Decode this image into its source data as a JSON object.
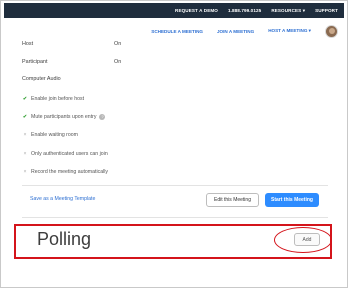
{
  "topbar": {
    "request_demo": "REQUEST A DEMO",
    "phone": "1.888.799.0125",
    "resources": "RESOURCES ▾",
    "support": "SUPPORT"
  },
  "nav": {
    "schedule": "SCHEDULE A MEETING",
    "join": "JOIN A MEETING",
    "host": "HOST A MEETING ▾"
  },
  "settings": {
    "host_label": "Host",
    "host_value": "On",
    "participant_label": "Participant",
    "participant_value": "On",
    "computer_audio_label": "Computer Audio"
  },
  "options": [
    {
      "label": "Enable join before host",
      "enabled": true
    },
    {
      "label": "Mute participants upon entry",
      "enabled": true
    },
    {
      "label": "Enable waiting room",
      "enabled": false
    },
    {
      "label": "Only authenticated users can join",
      "enabled": false
    },
    {
      "label": "Record the meeting automatically",
      "enabled": false
    }
  ],
  "icons": {
    "check": "check-icon",
    "cross": "x-icon",
    "info": "info-icon"
  },
  "actions": {
    "save_template": "Save as a Meeting Template",
    "edit": "Edit this Meeting",
    "start": "Start this Meeting"
  },
  "polling": {
    "title": "Polling",
    "add": "Add"
  },
  "colors": {
    "accent": "#2d8cff",
    "link": "#2d6fd2",
    "highlight": "#d4141b",
    "topbar": "#1f2d3d"
  }
}
